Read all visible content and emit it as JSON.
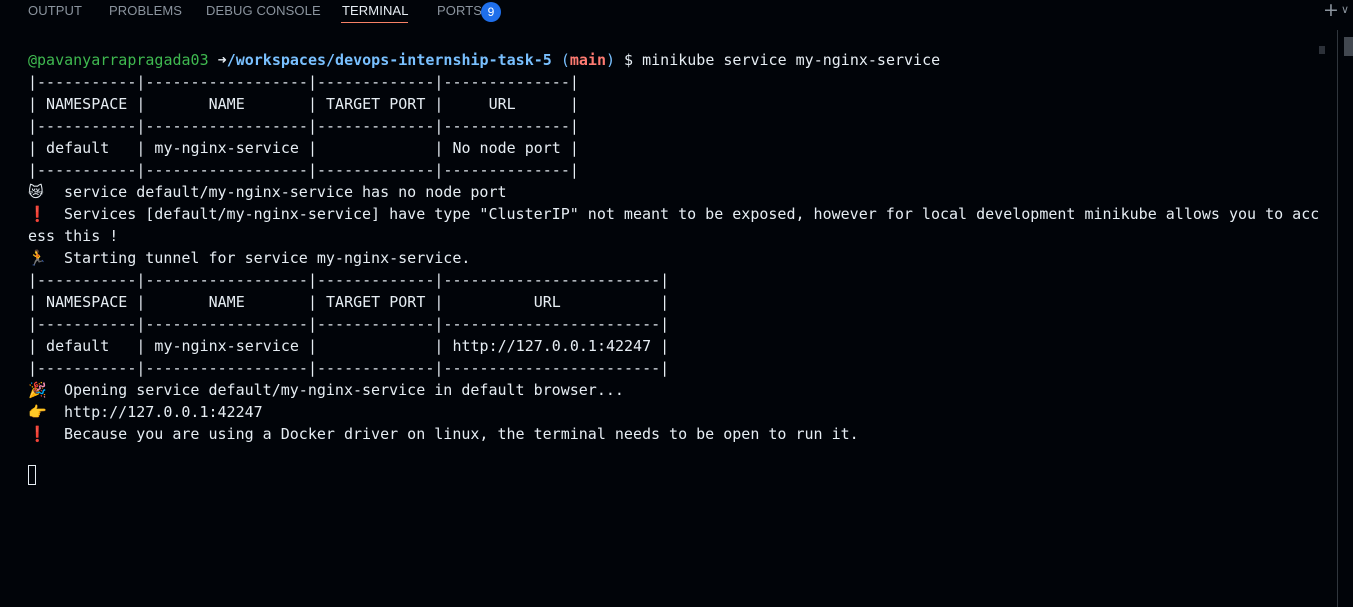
{
  "panel": {
    "tabs": [
      {
        "label": "OUTPUT"
      },
      {
        "label": "PROBLEMS"
      },
      {
        "label": "DEBUG CONSOLE"
      },
      {
        "label": "TERMINAL",
        "active": true
      },
      {
        "label": "PORTS",
        "badge": "9"
      }
    ],
    "new_terminal_icon": "plus-icon",
    "menu_icon": "chevron-down-icon"
  },
  "terminal": {
    "prompt": {
      "user": "@pavanyarrapragada03",
      "arrow": "➜",
      "path": "/workspaces/devops-internship-task-5",
      "branch_open": "(",
      "branch": "main",
      "branch_close": ")",
      "symbol": "$",
      "command": "minikube service my-nginx-service"
    },
    "table1": [
      "|-----------|------------------|-------------|--------------|",
      "| NAMESPACE |       NAME       | TARGET PORT |     URL      |",
      "|-----------|------------------|-------------|--------------|",
      "| default   | my-nginx-service |             | No node port |",
      "|-----------|------------------|-------------|--------------|"
    ],
    "msg_no_node_port": {
      "icon": "😿",
      "text": "service default/my-nginx-service has no node port"
    },
    "msg_clusterip": {
      "icon": "❗",
      "text": "Services [default/my-nginx-service] have type \"ClusterIP\" not meant to be exposed, however for local development minikube allows you to acc"
    },
    "msg_clusterip_wrap": "ess this !",
    "msg_tunnel": {
      "icon": "🏃",
      "text": "Starting tunnel for service my-nginx-service."
    },
    "table2": [
      "|-----------|------------------|-------------|------------------------|",
      "| NAMESPACE |       NAME       | TARGET PORT |          URL           |",
      "|-----------|------------------|-------------|------------------------|",
      "| default   | my-nginx-service |             | http://127.0.0.1:42247 |",
      "|-----------|------------------|-------------|------------------------|"
    ],
    "msg_opening": {
      "icon": "🎉",
      "text": "Opening service default/my-nginx-service in default browser..."
    },
    "msg_url": {
      "icon": "👉",
      "text": "http://127.0.0.1:42247"
    },
    "msg_docker": {
      "icon": "❗",
      "text": "Because you are using a Docker driver on linux, the terminal needs to be open to run it."
    }
  },
  "colors": {
    "background": "#010409",
    "prompt_user": "#3fb950",
    "prompt_path": "#79c0ff",
    "prompt_branch": "#ff7b72",
    "accent_tab_underline": "#f78166",
    "badge": "#1f6feb"
  }
}
